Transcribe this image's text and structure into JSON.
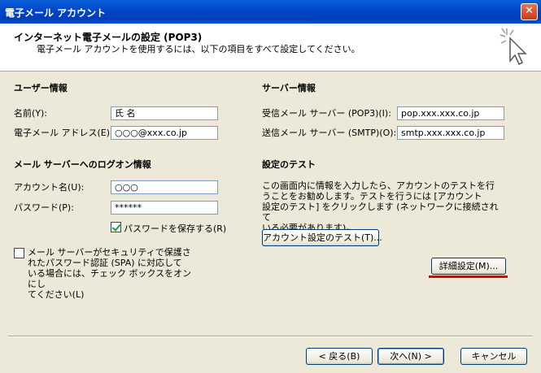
{
  "window": {
    "title": "電子メール アカウント",
    "close_glyph": "✕"
  },
  "header": {
    "title": "インターネット電子メールの設定 (POP3)",
    "subtitle": "電子メール アカウントを使用するには、以下の項目をすべて設定してください。"
  },
  "user_info": {
    "heading": "ユーザー情報",
    "name_label": "名前(Y):",
    "name_value": "氏 名",
    "email_label": "電子メール アドレス(E):",
    "email_value": "○○○@xxx.co.jp"
  },
  "server_info": {
    "heading": "サーバー情報",
    "incoming_label": "受信メール サーバー (POP3)(I):",
    "incoming_value": "pop.xxx.xxx.co.jp",
    "outgoing_label": "送信メール サーバー (SMTP)(O):",
    "outgoing_value": "smtp.xxx.xxx.co.jp"
  },
  "logon_info": {
    "heading": "メール サーバーへのログオン情報",
    "account_label": "アカウント名(U):",
    "account_value": "○○○",
    "password_label": "パスワード(P):",
    "password_value": "******",
    "save_password_label": "パスワードを保存する(R)",
    "save_password_checked": true
  },
  "spa": {
    "line1": "メール サーバーがセキュリティで保護さ",
    "line2": "れたパスワード認証 (SPA) に対応して",
    "line3": "いる場合には、チェック ボックスをオンにし",
    "line4": "てください(L)",
    "checked": false
  },
  "test": {
    "heading": "設定のテスト",
    "line1": "この画面内に情報を入力したら、アカウントのテストを行",
    "line2": "うことをお勧めします。テストを行うには [アカウント",
    "line3": "設定のテスト] をクリックします (ネットワークに接続されて",
    "line4": "いる必要があります)。",
    "test_button": "アカウント設定のテスト(T)...",
    "advanced_button": "詳細設定(M)..."
  },
  "footer": {
    "back_button": "< 戻る(B)",
    "next_button": "次へ(N) >",
    "cancel_button": "キャンセル"
  },
  "colors": {
    "highlight_underline": "#e00000",
    "titlebar": "#0046c8"
  },
  "icons": {
    "header_icon": "cursor-sparkle-icon",
    "close": "close-icon"
  }
}
